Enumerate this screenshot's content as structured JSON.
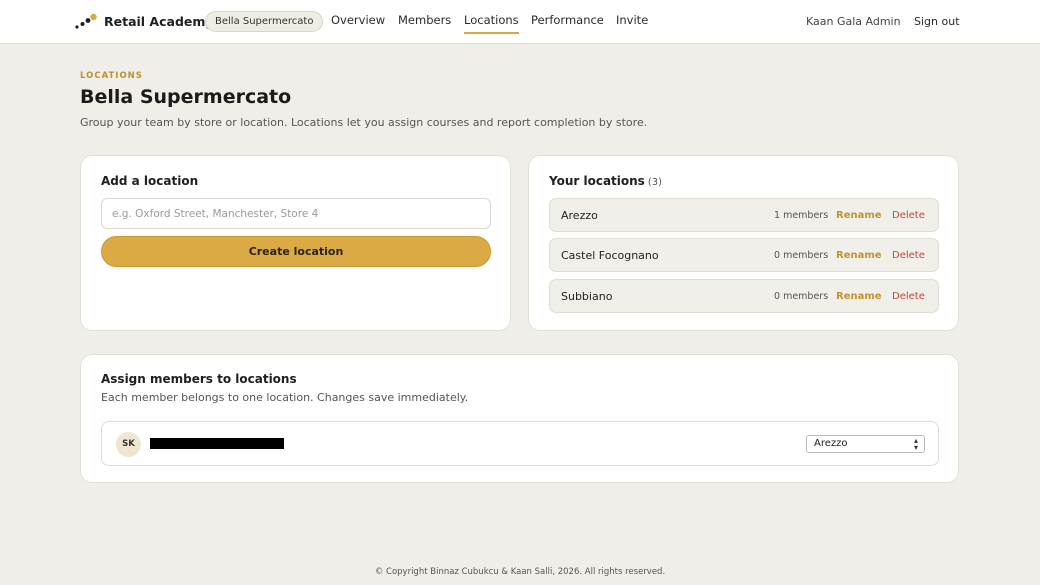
{
  "nav": {
    "brand": "Retail Academy",
    "org": "Bella Supermercato",
    "links": [
      {
        "label": "Overview"
      },
      {
        "label": "Members"
      },
      {
        "label": "Locations"
      },
      {
        "label": "Performance"
      },
      {
        "label": "Invite"
      }
    ],
    "active_link": "Locations",
    "user": "Kaan Gala Admin",
    "signout": "Sign out"
  },
  "header": {
    "eyebrow": "LOCATIONS",
    "title": "Bella Supermercato",
    "subtitle": "Group your team by store or location. Locations let you assign courses and report completion by store."
  },
  "add_location": {
    "title": "Add a location",
    "placeholder": "e.g. Oxford Street, Manchester, Store 4",
    "button": "Create location"
  },
  "your_locations": {
    "title": "Your locations",
    "count": "(3)",
    "items": [
      {
        "name": "Arezzo",
        "members": "1 members",
        "rename": "Rename",
        "delete": "Delete"
      },
      {
        "name": "Castel Focognano",
        "members": "0 members",
        "rename": "Rename",
        "delete": "Delete"
      },
      {
        "name": "Subbiano",
        "members": "0 members",
        "rename": "Rename",
        "delete": "Delete"
      }
    ]
  },
  "assign": {
    "title": "Assign members to locations",
    "subtitle": "Each member belongs to one location. Changes save immediately.",
    "members": [
      {
        "initials": "SK",
        "location": "Arezzo"
      }
    ]
  },
  "footer": "© Copyright Binnaz Cubukcu & Kaan Salli, 2026. All rights reserved.",
  "colors": {
    "accent": "#dcaa45",
    "accent_text": "#c2922e",
    "danger": "#c0473a",
    "background": "#f0eee9"
  }
}
